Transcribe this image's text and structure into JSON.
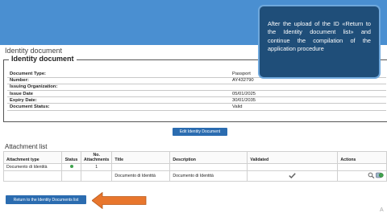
{
  "section_heading": "Identity document",
  "legend": "Identity document",
  "fields": [
    {
      "label": "Document Type:",
      "value": "Passport"
    },
    {
      "label": "Number:",
      "value": "AY432790"
    },
    {
      "label": "Issuing Organization:",
      "value": ""
    },
    {
      "label": "Issue Date",
      "value": "05/01/2025"
    },
    {
      "label": "Expiry Date:",
      "value": "30/01/2035"
    },
    {
      "label": "Document Status:",
      "value": "Valid"
    }
  ],
  "edit_button_label": "Edit Identity Document",
  "attachment_list_title": "Attachment list",
  "attachment_table": {
    "headers": {
      "attachment_type": "Attachment type",
      "status": "Status",
      "no_attachments_line1": "No.",
      "no_attachments_line2": "Attachments",
      "title": "Title",
      "description": "Description",
      "validated": "Validated",
      "actions": "Actions"
    },
    "group_row": {
      "attachment_type": "Documento di Identità",
      "count": "1"
    },
    "file_row": {
      "title": "Documento di Identità",
      "description": "Documento di Identità"
    }
  },
  "return_button_label": "Return to the Identity Documents list",
  "callout_text": "After the upload of the ID «Return to the Identity document list» and continue the compilation of the application procedure",
  "colors": {
    "banner": "#4a8fd1",
    "button": "#2b6cb0",
    "callout_bg": "#1f4e79",
    "arrow": "#e8762d",
    "status_ok": "#3fa34d"
  },
  "corner_mark": "A"
}
